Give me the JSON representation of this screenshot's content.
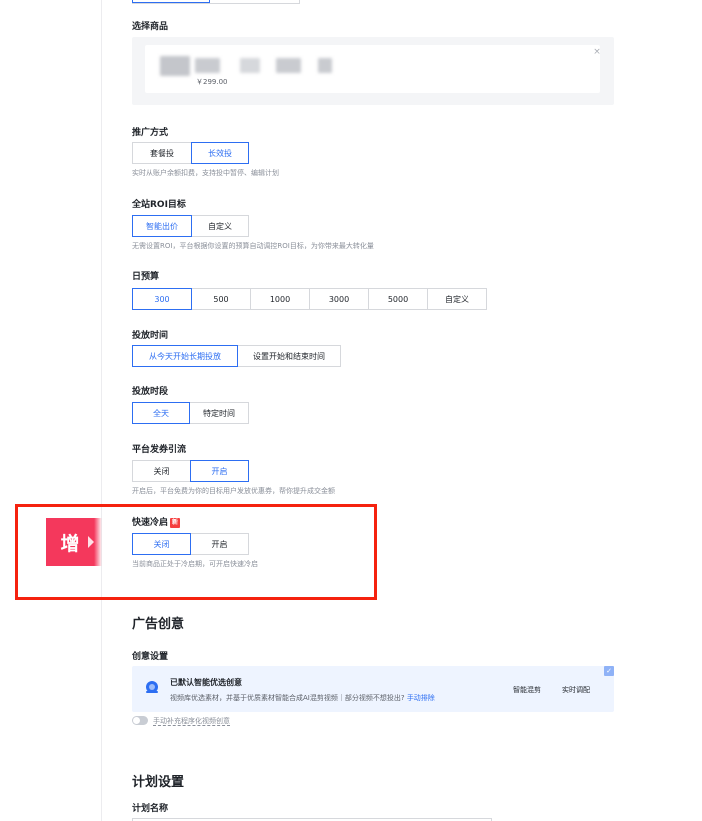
{
  "product": {
    "label": "选择商品",
    "price": "￥299.00",
    "close": "×"
  },
  "promo_method": {
    "label": "推广方式",
    "options": [
      "套餐投",
      "长效投"
    ],
    "selected": "长效投",
    "hint": "实时从账户余额扣费，支持投中暂停、编辑计划"
  },
  "roi_target": {
    "label": "全站ROI目标",
    "options": [
      "智能出价",
      "自定义"
    ],
    "selected": "智能出价",
    "hint": "无需设置ROI，平台根据你设置的预算自动调控ROI目标，为你带来最大转化量"
  },
  "daily_budget": {
    "label": "日预算",
    "options": [
      "300",
      "500",
      "1000",
      "3000",
      "5000",
      "自定义"
    ],
    "selected": "300"
  },
  "delivery_time": {
    "label": "投放时间",
    "options": [
      "从今天开始长期投放",
      "设置开始和结束时间"
    ],
    "selected": "从今天开始长期投放"
  },
  "delivery_period": {
    "label": "投放时段",
    "options": [
      "全天",
      "特定时间"
    ],
    "selected": "全天"
  },
  "coupon_traffic": {
    "label": "平台发券引流",
    "options": [
      "关闭",
      "开启"
    ],
    "selected": "开启",
    "hint": "开启后，平台免费为你的目标用户发放优惠券，帮你提升成交金额"
  },
  "quick_cold_start": {
    "label": "快速冷启",
    "badge": "新",
    "options": [
      "关闭",
      "开启"
    ],
    "selected": "关闭",
    "hint": "当前商品正处于冷启期，可开启快速冷启"
  },
  "annotation_tag": "增",
  "ad_creative": {
    "section_title": "广告创意",
    "settings_label": "创意设置",
    "card_title": "已默认智能优选创意",
    "card_desc": "视频库优选素材，并基于优质素材智能合成AI混剪视频｜部分视频不想投出?",
    "card_link": "手动排除",
    "mode_smart": "智能混剪",
    "mode_realtime": "实时调配",
    "toggle_label": "手动补充程序化视频创意"
  },
  "plan_settings": {
    "section_title": "计划设置",
    "name_label": "计划名称"
  },
  "colors": {
    "accent": "#2d6ef2",
    "highlight_frame": "#f5220f",
    "tag": "#f4385c"
  }
}
